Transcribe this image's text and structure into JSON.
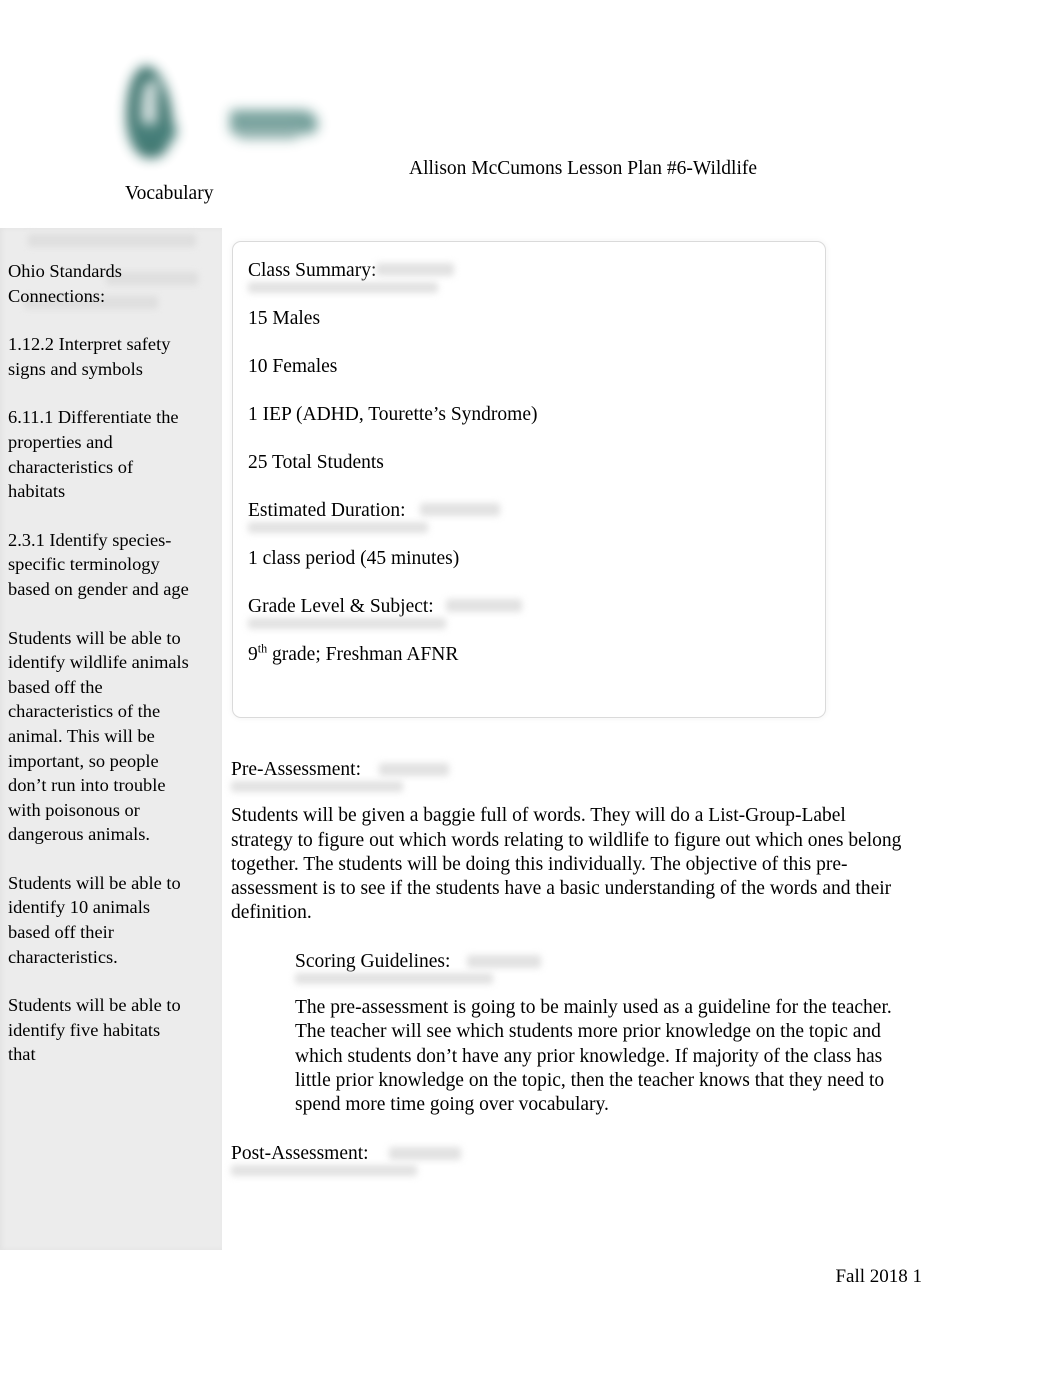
{
  "document": {
    "header": {
      "logo_alt": "institution-logo",
      "logo_color": "#3d7872",
      "title_line1": "Allison McCumons Lesson Plan #6-Wildlife",
      "title_line2": "Vocabulary"
    },
    "footer": {
      "text": "Fall 2018 1"
    }
  },
  "sidebar": {
    "heading": "Ohio Standards Connections:",
    "background_color": "#ececec",
    "paragraphs": [
      "1.12.2 Interpret safety signs and symbols",
      "6.11.1 Differentiate the properties and characteristics of habitats",
      "2.3.1 Identify species-specific terminology based on gender and age",
      "Students will be able to identify wildlife animals based off the characteristics of the animal. This will be important, so people don’t run into trouble with poisonous or dangerous animals.",
      "Students will be able to identify 10 animals based off their characteristics.",
      "Students will be able to identify five habitats that"
    ]
  },
  "class_summary": {
    "heading": "Class Summary:",
    "lines": [
      "15 Males",
      "10 Females",
      "1 IEP (ADHD, Tourette’s Syndrome)",
      "25 Total Students"
    ],
    "duration_heading": "Estimated Duration:",
    "duration_value": "1 class period (45 minutes)",
    "grade_heading": "Grade Level & Subject:",
    "grade_value_number": "9",
    "grade_value_suffix": "th",
    "grade_value_rest": " grade; Freshman AFNR"
  },
  "main": {
    "pre_assessment": {
      "heading": "Pre-Assessment:",
      "body": "Students will be given a baggie full of words. They will do a List-Group-Label strategy to figure out which words relating to wildlife to figure out which ones belong together. The students will be doing this individually. The objective of this pre-assessment is to see if the students have a basic understanding of the words and their definition."
    },
    "scoring_guidelines": {
      "heading": "Scoring Guidelines:",
      "body": "The pre-assessment is going to be mainly used as a guideline for the teacher. The teacher will see which students more prior knowledge on the topic and which students don’t have any prior knowledge. If majority of the class has little prior knowledge on the topic, then the teacher knows that they need to spend more time going over vocabulary."
    },
    "post_assessment": {
      "heading": "Post-Assessment:"
    }
  }
}
